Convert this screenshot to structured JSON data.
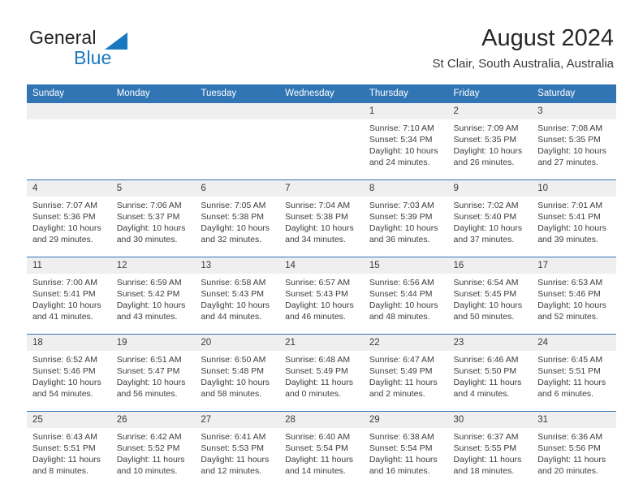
{
  "brand": {
    "name_part1": "General",
    "name_part2": "Blue",
    "triangle_color": "#1878c0",
    "text_color": "#231f20"
  },
  "header": {
    "title": "August 2024",
    "subtitle": "St Clair, South Australia, Australia"
  },
  "theme": {
    "header_blue": "#3175b4",
    "daynum_band": "#efeff0",
    "cell_background": "#ffffff",
    "text": "#3c3c3c"
  },
  "calendar": {
    "weekday_headers": [
      "Sunday",
      "Monday",
      "Tuesday",
      "Wednesday",
      "Thursday",
      "Friday",
      "Saturday"
    ],
    "weeks": [
      [
        {
          "day": "",
          "sunrise": "",
          "sunset": "",
          "daylight_line1": "",
          "daylight_line2": ""
        },
        {
          "day": "",
          "sunrise": "",
          "sunset": "",
          "daylight_line1": "",
          "daylight_line2": ""
        },
        {
          "day": "",
          "sunrise": "",
          "sunset": "",
          "daylight_line1": "",
          "daylight_line2": ""
        },
        {
          "day": "",
          "sunrise": "",
          "sunset": "",
          "daylight_line1": "",
          "daylight_line2": ""
        },
        {
          "day": "1",
          "sunrise": "Sunrise: 7:10 AM",
          "sunset": "Sunset: 5:34 PM",
          "daylight_line1": "Daylight: 10 hours",
          "daylight_line2": "and 24 minutes."
        },
        {
          "day": "2",
          "sunrise": "Sunrise: 7:09 AM",
          "sunset": "Sunset: 5:35 PM",
          "daylight_line1": "Daylight: 10 hours",
          "daylight_line2": "and 26 minutes."
        },
        {
          "day": "3",
          "sunrise": "Sunrise: 7:08 AM",
          "sunset": "Sunset: 5:35 PM",
          "daylight_line1": "Daylight: 10 hours",
          "daylight_line2": "and 27 minutes."
        }
      ],
      [
        {
          "day": "4",
          "sunrise": "Sunrise: 7:07 AM",
          "sunset": "Sunset: 5:36 PM",
          "daylight_line1": "Daylight: 10 hours",
          "daylight_line2": "and 29 minutes."
        },
        {
          "day": "5",
          "sunrise": "Sunrise: 7:06 AM",
          "sunset": "Sunset: 5:37 PM",
          "daylight_line1": "Daylight: 10 hours",
          "daylight_line2": "and 30 minutes."
        },
        {
          "day": "6",
          "sunrise": "Sunrise: 7:05 AM",
          "sunset": "Sunset: 5:38 PM",
          "daylight_line1": "Daylight: 10 hours",
          "daylight_line2": "and 32 minutes."
        },
        {
          "day": "7",
          "sunrise": "Sunrise: 7:04 AM",
          "sunset": "Sunset: 5:38 PM",
          "daylight_line1": "Daylight: 10 hours",
          "daylight_line2": "and 34 minutes."
        },
        {
          "day": "8",
          "sunrise": "Sunrise: 7:03 AM",
          "sunset": "Sunset: 5:39 PM",
          "daylight_line1": "Daylight: 10 hours",
          "daylight_line2": "and 36 minutes."
        },
        {
          "day": "9",
          "sunrise": "Sunrise: 7:02 AM",
          "sunset": "Sunset: 5:40 PM",
          "daylight_line1": "Daylight: 10 hours",
          "daylight_line2": "and 37 minutes."
        },
        {
          "day": "10",
          "sunrise": "Sunrise: 7:01 AM",
          "sunset": "Sunset: 5:41 PM",
          "daylight_line1": "Daylight: 10 hours",
          "daylight_line2": "and 39 minutes."
        }
      ],
      [
        {
          "day": "11",
          "sunrise": "Sunrise: 7:00 AM",
          "sunset": "Sunset: 5:41 PM",
          "daylight_line1": "Daylight: 10 hours",
          "daylight_line2": "and 41 minutes."
        },
        {
          "day": "12",
          "sunrise": "Sunrise: 6:59 AM",
          "sunset": "Sunset: 5:42 PM",
          "daylight_line1": "Daylight: 10 hours",
          "daylight_line2": "and 43 minutes."
        },
        {
          "day": "13",
          "sunrise": "Sunrise: 6:58 AM",
          "sunset": "Sunset: 5:43 PM",
          "daylight_line1": "Daylight: 10 hours",
          "daylight_line2": "and 44 minutes."
        },
        {
          "day": "14",
          "sunrise": "Sunrise: 6:57 AM",
          "sunset": "Sunset: 5:43 PM",
          "daylight_line1": "Daylight: 10 hours",
          "daylight_line2": "and 46 minutes."
        },
        {
          "day": "15",
          "sunrise": "Sunrise: 6:56 AM",
          "sunset": "Sunset: 5:44 PM",
          "daylight_line1": "Daylight: 10 hours",
          "daylight_line2": "and 48 minutes."
        },
        {
          "day": "16",
          "sunrise": "Sunrise: 6:54 AM",
          "sunset": "Sunset: 5:45 PM",
          "daylight_line1": "Daylight: 10 hours",
          "daylight_line2": "and 50 minutes."
        },
        {
          "day": "17",
          "sunrise": "Sunrise: 6:53 AM",
          "sunset": "Sunset: 5:46 PM",
          "daylight_line1": "Daylight: 10 hours",
          "daylight_line2": "and 52 minutes."
        }
      ],
      [
        {
          "day": "18",
          "sunrise": "Sunrise: 6:52 AM",
          "sunset": "Sunset: 5:46 PM",
          "daylight_line1": "Daylight: 10 hours",
          "daylight_line2": "and 54 minutes."
        },
        {
          "day": "19",
          "sunrise": "Sunrise: 6:51 AM",
          "sunset": "Sunset: 5:47 PM",
          "daylight_line1": "Daylight: 10 hours",
          "daylight_line2": "and 56 minutes."
        },
        {
          "day": "20",
          "sunrise": "Sunrise: 6:50 AM",
          "sunset": "Sunset: 5:48 PM",
          "daylight_line1": "Daylight: 10 hours",
          "daylight_line2": "and 58 minutes."
        },
        {
          "day": "21",
          "sunrise": "Sunrise: 6:48 AM",
          "sunset": "Sunset: 5:49 PM",
          "daylight_line1": "Daylight: 11 hours",
          "daylight_line2": "and 0 minutes."
        },
        {
          "day": "22",
          "sunrise": "Sunrise: 6:47 AM",
          "sunset": "Sunset: 5:49 PM",
          "daylight_line1": "Daylight: 11 hours",
          "daylight_line2": "and 2 minutes."
        },
        {
          "day": "23",
          "sunrise": "Sunrise: 6:46 AM",
          "sunset": "Sunset: 5:50 PM",
          "daylight_line1": "Daylight: 11 hours",
          "daylight_line2": "and 4 minutes."
        },
        {
          "day": "24",
          "sunrise": "Sunrise: 6:45 AM",
          "sunset": "Sunset: 5:51 PM",
          "daylight_line1": "Daylight: 11 hours",
          "daylight_line2": "and 6 minutes."
        }
      ],
      [
        {
          "day": "25",
          "sunrise": "Sunrise: 6:43 AM",
          "sunset": "Sunset: 5:51 PM",
          "daylight_line1": "Daylight: 11 hours",
          "daylight_line2": "and 8 minutes."
        },
        {
          "day": "26",
          "sunrise": "Sunrise: 6:42 AM",
          "sunset": "Sunset: 5:52 PM",
          "daylight_line1": "Daylight: 11 hours",
          "daylight_line2": "and 10 minutes."
        },
        {
          "day": "27",
          "sunrise": "Sunrise: 6:41 AM",
          "sunset": "Sunset: 5:53 PM",
          "daylight_line1": "Daylight: 11 hours",
          "daylight_line2": "and 12 minutes."
        },
        {
          "day": "28",
          "sunrise": "Sunrise: 6:40 AM",
          "sunset": "Sunset: 5:54 PM",
          "daylight_line1": "Daylight: 11 hours",
          "daylight_line2": "and 14 minutes."
        },
        {
          "day": "29",
          "sunrise": "Sunrise: 6:38 AM",
          "sunset": "Sunset: 5:54 PM",
          "daylight_line1": "Daylight: 11 hours",
          "daylight_line2": "and 16 minutes."
        },
        {
          "day": "30",
          "sunrise": "Sunrise: 6:37 AM",
          "sunset": "Sunset: 5:55 PM",
          "daylight_line1": "Daylight: 11 hours",
          "daylight_line2": "and 18 minutes."
        },
        {
          "day": "31",
          "sunrise": "Sunrise: 6:36 AM",
          "sunset": "Sunset: 5:56 PM",
          "daylight_line1": "Daylight: 11 hours",
          "daylight_line2": "and 20 minutes."
        }
      ]
    ]
  }
}
